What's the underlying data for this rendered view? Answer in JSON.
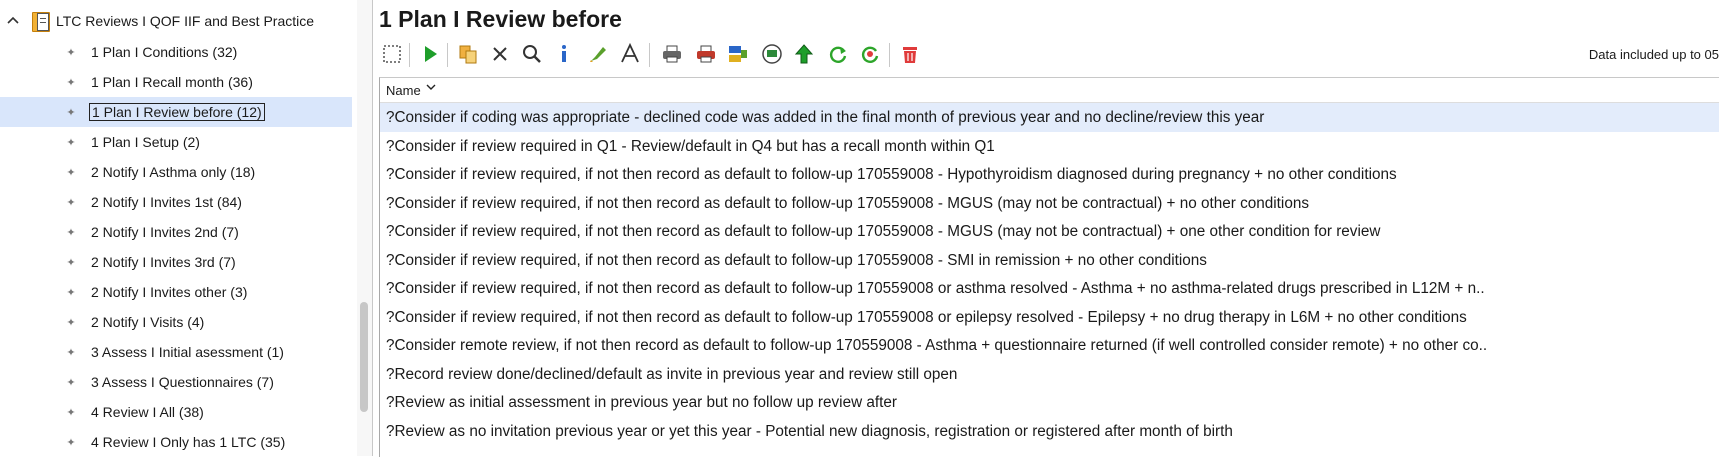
{
  "tree": {
    "root_label": "LTC Reviews I QOF IIF and Best Practice",
    "items": [
      {
        "label": "1 Plan I Conditions (32)",
        "selected": false
      },
      {
        "label": "1 Plan I Recall month (36)",
        "selected": false
      },
      {
        "label": "1 Plan I Review before (12)",
        "selected": true
      },
      {
        "label": "1 Plan I Setup (2)",
        "selected": false
      },
      {
        "label": "2 Notify I Asthma only (18)",
        "selected": false
      },
      {
        "label": "2 Notify I Invites 1st (84)",
        "selected": false
      },
      {
        "label": "2 Notify I Invites 2nd (7)",
        "selected": false
      },
      {
        "label": "2 Notify I Invites 3rd (7)",
        "selected": false
      },
      {
        "label": "2 Notify I Invites other (3)",
        "selected": false
      },
      {
        "label": "2 Notify I Visits (4)",
        "selected": false
      },
      {
        "label": "3 Assess I Initial asessment (1)",
        "selected": false
      },
      {
        "label": "3 Assess I Questionnaires (7)",
        "selected": false
      },
      {
        "label": "4 Review I All (38)",
        "selected": false
      },
      {
        "label": "4 Review I Only has 1 LTC (35)",
        "selected": false
      }
    ]
  },
  "main": {
    "title": "1 Plan I Review before",
    "data_included": "Data included up to 05",
    "column_header": "Name",
    "rows": [
      "?Consider if coding was appropriate - declined code was added in the final month of previous year and no decline/review this year",
      "?Consider if review required in Q1 - Review/default in Q4 but has a recall month within Q1",
      "?Consider if review required, if not then record as default to follow-up 170559008 - Hypothyroidism diagnosed during pregnancy + no other conditions",
      "?Consider if review required, if not then record as default to follow-up 170559008 - MGUS (may not be contractual) + no other conditions",
      "?Consider if review required, if not then record as default to follow-up 170559008 - MGUS (may not be contractual) + one other condition for review",
      "?Consider if review required, if not then record as default to follow-up 170559008 - SMI in remission + no other conditions",
      "?Consider if review required, if not then record as default to follow-up 170559008 or asthma resolved - Asthma + no asthma-related drugs prescribed in L12M + n..",
      "?Consider if review required, if not then record as default to follow-up 170559008 or epilepsy resolved - Epilepsy + no drug therapy in L6M + no other conditions",
      "?Consider remote review, if not then record as default to follow-up 170559008 - Asthma + questionnaire returned (if well controlled consider remote) + no other co..",
      "?Record review done/declined/default as invite in previous year and review still open",
      "?Review as initial assessment in previous year but no follow up review after",
      "?Review as no invitation previous year or yet this year - Potential new diagnosis, registration or registered after month of birth"
    ]
  },
  "colors": {
    "selection": "#d9e6fb",
    "row_selection": "#e3ecfb",
    "delete_red": "#e03b3b",
    "run_green": "#1e9e2a"
  }
}
